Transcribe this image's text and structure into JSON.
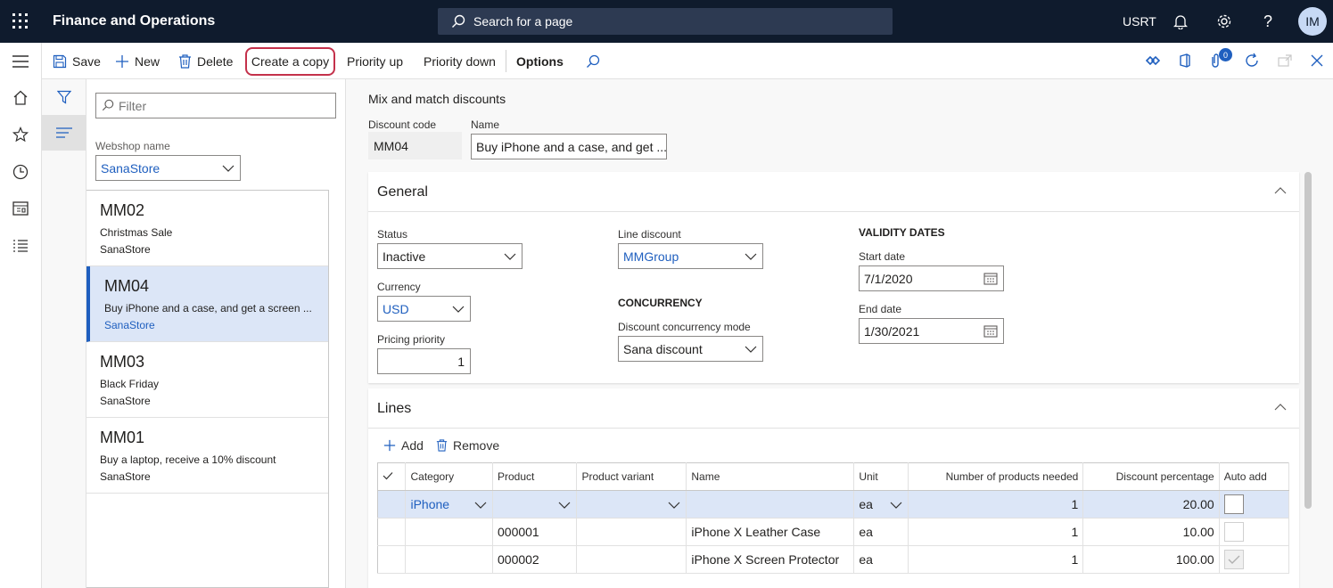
{
  "topbar": {
    "app_title": "Finance and Operations",
    "search_placeholder": "Search for a page",
    "company": "USRT",
    "avatar_initials": "IM"
  },
  "actions": {
    "save": "Save",
    "new": "New",
    "delete": "Delete",
    "create_copy": "Create a copy",
    "priority_up": "Priority up",
    "priority_down": "Priority down",
    "options": "Options",
    "attachments_badge": "0"
  },
  "list": {
    "filter_placeholder": "Filter",
    "webshop_label": "Webshop name",
    "webshop_value": "SanaStore",
    "items": [
      {
        "code": "MM02",
        "name": "Christmas Sale",
        "store": "SanaStore"
      },
      {
        "code": "MM04",
        "name": "Buy iPhone and a case, and get a screen ...",
        "store": "SanaStore"
      },
      {
        "code": "MM03",
        "name": "Black Friday",
        "store": "SanaStore"
      },
      {
        "code": "MM01",
        "name": "Buy a laptop, receive a 10% discount",
        "store": "SanaStore"
      }
    ]
  },
  "details": {
    "caption": "Mix and match discounts",
    "discount_code_label": "Discount code",
    "discount_code": "MM04",
    "name_label": "Name",
    "name": "Buy iPhone and a case, and get ..."
  },
  "general": {
    "title": "General",
    "status_label": "Status",
    "status": "Inactive",
    "currency_label": "Currency",
    "currency": "USD",
    "pricing_priority_label": "Pricing priority",
    "pricing_priority": "1",
    "line_discount_label": "Line discount",
    "line_discount": "MMGroup",
    "concurrency_heading": "CONCURRENCY",
    "concurrency_mode_label": "Discount concurrency mode",
    "concurrency_mode": "Sana discount",
    "validity_heading": "VALIDITY DATES",
    "start_date_label": "Start date",
    "start_date": "7/1/2020",
    "end_date_label": "End date",
    "end_date": "1/30/2021"
  },
  "lines": {
    "title": "Lines",
    "add": "Add",
    "remove": "Remove",
    "columns": [
      "Category",
      "Product",
      "Product variant",
      "Name",
      "Unit",
      "Number of products needed",
      "Discount percentage",
      "Auto add"
    ],
    "rows": [
      {
        "category": "iPhone",
        "product": "",
        "variant": "",
        "name": "",
        "unit": "ea",
        "needed": "1",
        "discount": "20.00",
        "auto_add": false
      },
      {
        "category": "",
        "product": "000001",
        "variant": "",
        "name": "iPhone X Leather Case",
        "unit": "ea",
        "needed": "1",
        "discount": "10.00",
        "auto_add": false
      },
      {
        "category": "",
        "product": "000002",
        "variant": "",
        "name": "iPhone X Screen Protector",
        "unit": "ea",
        "needed": "1",
        "discount": "100.00",
        "auto_add": true
      }
    ]
  }
}
